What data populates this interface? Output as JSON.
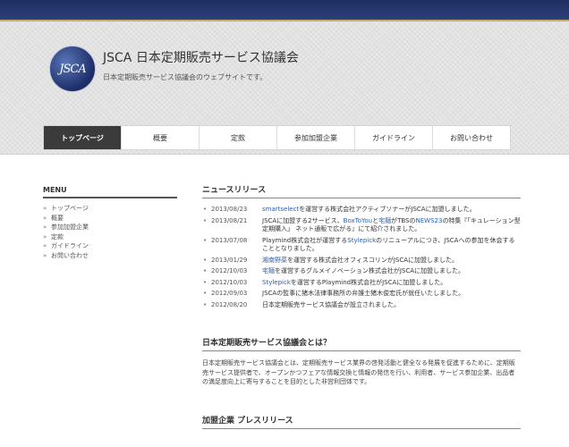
{
  "site": {
    "logo_text": "JSCA",
    "title": "JSCA 日本定期販売サービス協議会",
    "description": "日本定期販売サービス協議会のウェブサイトです。"
  },
  "nav": {
    "items": [
      {
        "label": "トップページ",
        "active": true
      },
      {
        "label": "概要"
      },
      {
        "label": "定款"
      },
      {
        "label": "参加加盟企業"
      },
      {
        "label": "ガイドライン"
      },
      {
        "label": "お問い合わせ"
      }
    ]
  },
  "sidebar": {
    "title": "MENU",
    "items": [
      "トップページ",
      "概要",
      "参加加盟企業",
      "定款",
      "ガイドライン",
      "お問い合わせ"
    ]
  },
  "news": {
    "title": "ニュースリリース",
    "items": [
      {
        "date": "2013/08/23",
        "parts": [
          {
            "text": "smartselect",
            "link": true
          },
          {
            "text": "を運営する株式会社アクティブソナーがJSCAに加盟しました。"
          }
        ]
      },
      {
        "date": "2013/08/21",
        "parts": [
          {
            "text": "JSCAに加盟する2サービス、"
          },
          {
            "text": "BoxToYou",
            "link": true
          },
          {
            "text": "と"
          },
          {
            "text": "宅麺",
            "link": true
          },
          {
            "text": "がTBSの"
          },
          {
            "text": "NEWS23",
            "link": true
          },
          {
            "text": "の特集『「キュレーション型定期購入」 ネット通販で広がる』にて紹介されました。"
          }
        ]
      },
      {
        "date": "2013/07/08",
        "parts": [
          {
            "text": "Playmind株式会社が運営する"
          },
          {
            "text": "Stylepick",
            "link": true
          },
          {
            "text": "のリニューアルにつき、JSCAへの参加を休会することとなりました。"
          }
        ]
      },
      {
        "date": "2013/01/29",
        "parts": [
          {
            "text": "湘南野菜",
            "link": true
          },
          {
            "text": "を運営する株式会社オフィスコリンがJSCAに加盟しました。"
          }
        ]
      },
      {
        "date": "2012/10/03",
        "parts": [
          {
            "text": "宅麺",
            "link": true
          },
          {
            "text": "を運営するグルメイノベーション株式会社がJSCAに加盟しました。"
          }
        ]
      },
      {
        "date": "2012/10/03",
        "parts": [
          {
            "text": "Stylepick",
            "link": true
          },
          {
            "text": "を運営するPlaymind株式会社がJSCAに加盟しました。"
          }
        ]
      },
      {
        "date": "2012/09/03",
        "parts": [
          {
            "text": "JSCAの監事に猪木法律事務所の弁護士猪木俊宏氏が就任いたしました。"
          }
        ]
      },
      {
        "date": "2012/08/20",
        "parts": [
          {
            "text": "日本定期販売サービス協議会が設立されました。"
          }
        ]
      }
    ]
  },
  "about": {
    "title": "日本定期販売サービス協議会とは？",
    "text": "日本定期販売サービス協議会とは、定期販売サービス業界の啓発活動と健全なる発展を促進するために、定期販売サービス提供者で、オープンかつフェアな情報交換と情報の発信を行い、利用者、サービス参加企業、出品者の満足度向上に寄与することを目的とした非営利団体です。"
  },
  "press": {
    "title": "加盟企業 プレスリリース"
  }
}
